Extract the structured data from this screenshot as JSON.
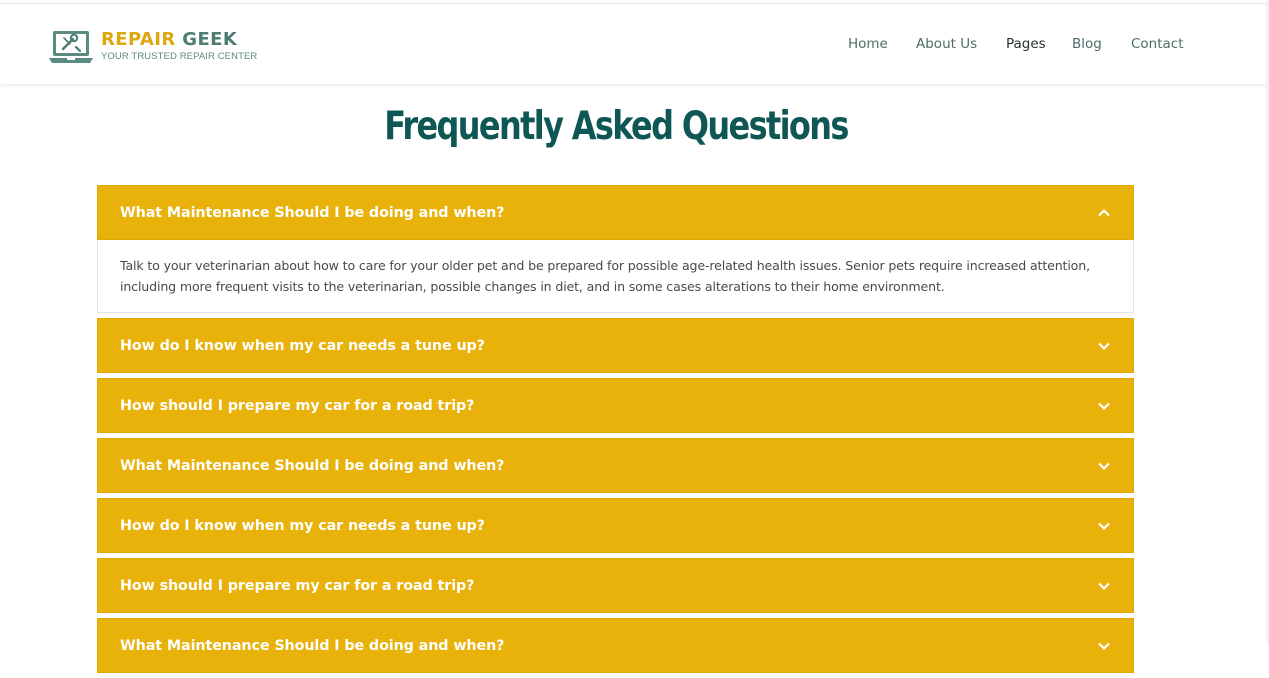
{
  "brand": {
    "name_part1": "REPAIR",
    "name_part2": "GEEK",
    "tagline": "YOUR TRUSTED REPAIR CENTER",
    "colors": {
      "primary": "#dfa70e",
      "secondary": "#4f7c72"
    }
  },
  "nav": {
    "items": [
      {
        "label": "Home"
      },
      {
        "label": "About Us"
      },
      {
        "label": "Pages"
      },
      {
        "label": "Blog"
      },
      {
        "label": "Contact"
      }
    ],
    "active": "Pages"
  },
  "page": {
    "title": "Frequently Asked Questions",
    "title_color": "#0e5754",
    "accent_color": "#e8b20a"
  },
  "faq": [
    {
      "question": "What Maintenance Should I be doing and when?",
      "expanded": true,
      "answer": "Talk to your veterinarian about how to care for your older pet and be prepared for possible age-related health issues. Senior pets require increased attention, including more frequent visits to the veterinarian, possible changes in diet, and in some cases alterations to their home environment."
    },
    {
      "question": "How do I know when my car needs a tune up?",
      "expanded": false
    },
    {
      "question": "How should I prepare my car for a road trip?",
      "expanded": false
    },
    {
      "question": "What Maintenance Should I be doing and when?",
      "expanded": false
    },
    {
      "question": "How do I know when my car needs a tune up?",
      "expanded": false
    },
    {
      "question": "How should I prepare my car for a road trip?",
      "expanded": false
    },
    {
      "question": "What Maintenance Should I be doing and when?",
      "expanded": false
    }
  ],
  "icons": {
    "logo": "laptop-wrench-icon",
    "expanded": "chevron-up-icon",
    "collapsed": "chevron-down-icon"
  }
}
